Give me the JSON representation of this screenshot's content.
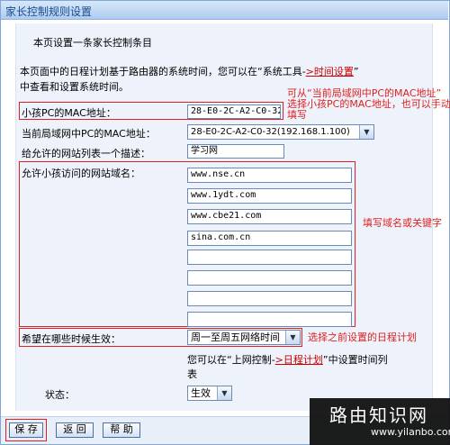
{
  "window": {
    "title": "家长控制规则设置"
  },
  "intro": {
    "line1": "本页设置一条家长控制条目",
    "line2a": "本页面中的日程计划基于路由器的系统时间，您可以在“系统工具-",
    "line2_link": ">时间设置",
    "line2b": "”",
    "line3": "中查看和设置系统时间。"
  },
  "form": {
    "child_mac_label": "小孩PC的MAC地址：",
    "child_mac_value": "28-E0-2C-A2-C0-32",
    "lan_mac_label": "当前局域网中PC的MAC地址：",
    "lan_mac_value": "28-E0-2C-A2-C0-32(192.168.1.100)",
    "desc_label": "给允许的网站列表一个描述：",
    "desc_value": "学习网",
    "sites_label": "允许小孩访问的网站域名：",
    "sites": [
      "www.nse.cn",
      "www.1ydt.com",
      "www.cbe21.com",
      "sina.com.cn",
      "",
      "",
      "",
      ""
    ],
    "schedule_label": "希望在哪些时候生效：",
    "schedule_value": "周一至周五网络时间",
    "schedule_hint_a": "您可以在“上网控制-",
    "schedule_hint_link": ">日程计划",
    "schedule_hint_b": "”中设置时间列",
    "schedule_hint_c": "表",
    "status_label": "状态：",
    "status_value": "生效"
  },
  "annotations": {
    "mac_note_1": "可从“当前局域网中PC的MAC地址”",
    "mac_note_2": "选择小孩PC的MAC地址，也可以手动",
    "mac_note_3": "填写",
    "sites_note": "填写域名或关键字",
    "schedule_note": "选择之前设置的日程计划"
  },
  "buttons": {
    "save": "保 存",
    "back": "返 回",
    "help": "帮 助"
  },
  "watermark": {
    "title": "路由知识网",
    "url": "www.yilanbo.com"
  },
  "colors": {
    "annotation_red": "#e02020",
    "link_red": "#cc0000",
    "title_blue": "#1b4c8c"
  }
}
